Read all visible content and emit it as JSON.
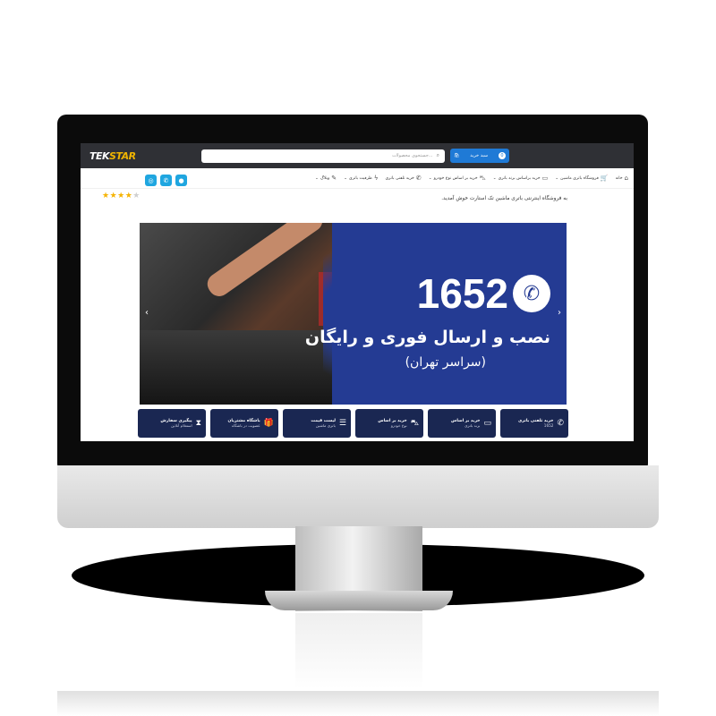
{
  "header": {
    "logo_text_a": "TEK",
    "logo_text_b": "STAR",
    "search_placeholder": "جستجوی محصولات...",
    "cart_label": "سبد خرید",
    "cart_count": "0"
  },
  "nav": {
    "items": [
      {
        "label": "خانه",
        "icon": "home-icon"
      },
      {
        "label": "فروشگاه باتری ماشین",
        "icon": "cart-icon"
      },
      {
        "label": "خرید براساس برند باتری",
        "icon": "battery-icon"
      },
      {
        "label": "خرید بر اساس نوع خودرو",
        "icon": "car-icon"
      },
      {
        "label": "خرید تلفنی باتری",
        "icon": "phone-icon"
      },
      {
        "label": "ظرفیت باتری",
        "icon": "bolt-icon"
      },
      {
        "label": "وبلاگ",
        "icon": "blog-icon"
      }
    ]
  },
  "rating": {
    "stars_on": "★★★★",
    "stars_off": "★"
  },
  "welcome_text": "به فروشگاه اینترنتی باتری ماشین تک استارت خوش آمدید.",
  "banner": {
    "number": "1652",
    "headline": "نصب و ارسال فوری و رایگان",
    "subline": "(سراسر تهران)",
    "prev": "‹",
    "next": "›"
  },
  "cards": [
    {
      "title": "خرید تلفنی باتری",
      "sub": "1652",
      "icon": "phone-icon"
    },
    {
      "title": "خرید بر اساس",
      "sub": "برند باتری",
      "icon": "battery-icon"
    },
    {
      "title": "خرید بر اساس",
      "sub": "نوع خودرو",
      "icon": "car-icon"
    },
    {
      "title": "لیست قیمت",
      "sub": "باتری ماشین",
      "icon": "list-icon"
    },
    {
      "title": "باشگاه مشتریان",
      "sub": "عضویت در باشگاه",
      "icon": "gift-icon"
    },
    {
      "title": "پیگیری سفارش",
      "sub": "استعلام آنلاین",
      "icon": "hourglass-icon"
    }
  ]
}
